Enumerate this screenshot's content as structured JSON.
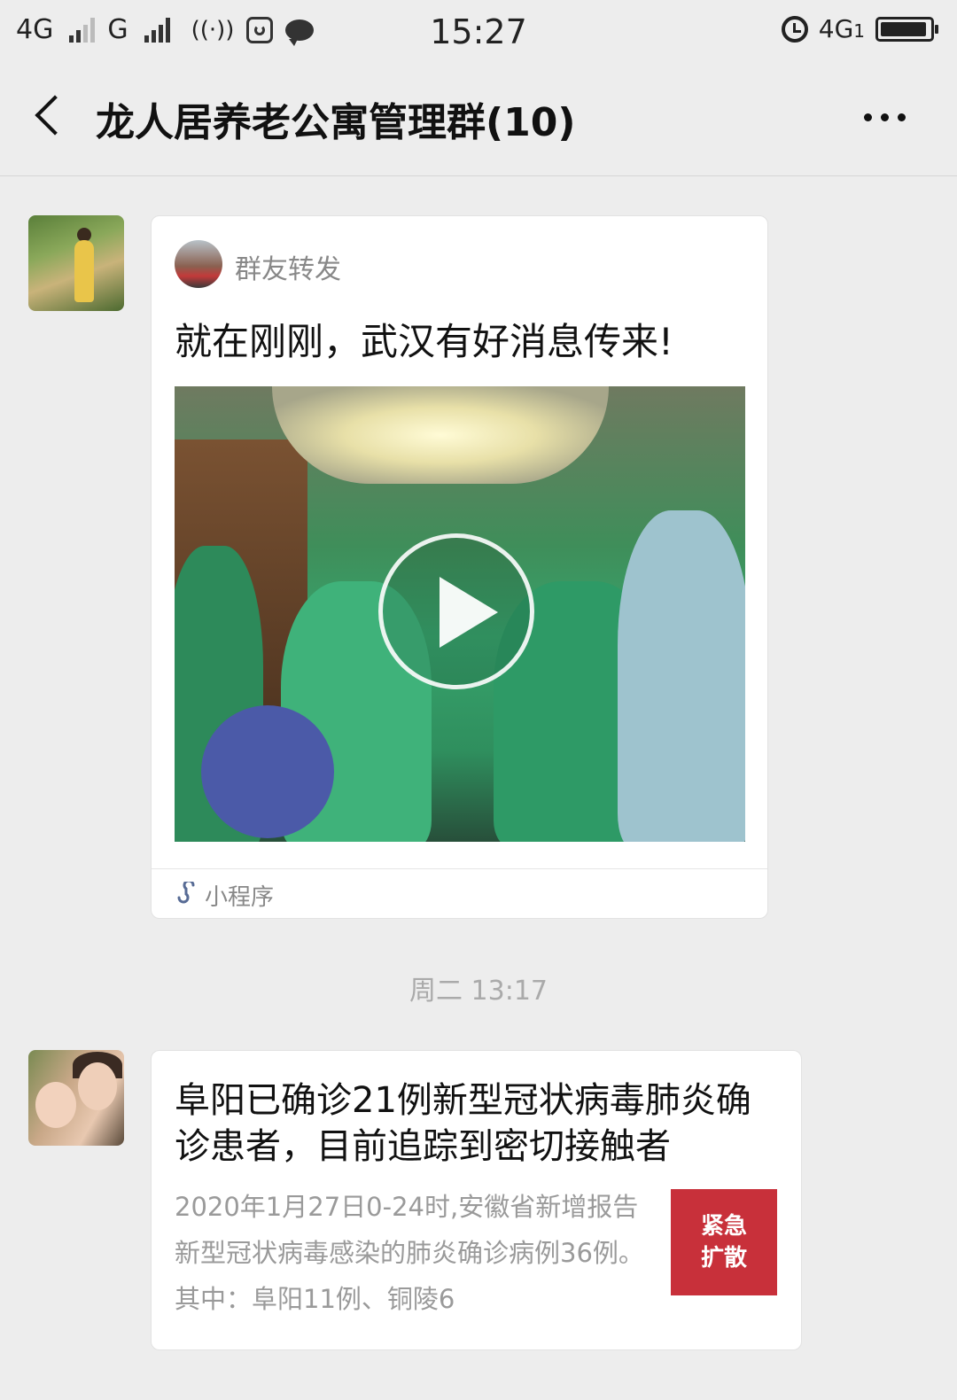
{
  "status_bar": {
    "network1": "4G",
    "network2": "G",
    "time": "15:27",
    "network_right": "4G",
    "sim_index": "1",
    "battery_level": 0.95
  },
  "header": {
    "title": "龙人居养老公寓管理群(10)"
  },
  "messages": [
    {
      "type": "mini_program",
      "source_name": "群友转发",
      "title": "就在刚刚，武汉有好消息传来!",
      "footer_label": "小程序"
    },
    {
      "type": "timestamp",
      "text": "周二 13:17"
    },
    {
      "type": "article",
      "title": "阜阳已确诊21例新型冠状病毒肺炎确诊患者，目前追踪到密切接触者",
      "description": "2020年1月27日0-24时,安徽省新增报告新型冠状病毒感染的肺炎确诊病例36例。其中：阜阳11例、铜陵6",
      "badge": "紧急扩散"
    }
  ],
  "colors": {
    "background": "#ededed",
    "card": "#ffffff",
    "badge": "#c8303a",
    "muted_text": "#888888",
    "link_icon": "#576b95"
  },
  "icons": [
    "back-arrow-icon",
    "more-icon",
    "play-icon",
    "mini-program-link-icon",
    "alarm-icon",
    "battery-icon"
  ]
}
